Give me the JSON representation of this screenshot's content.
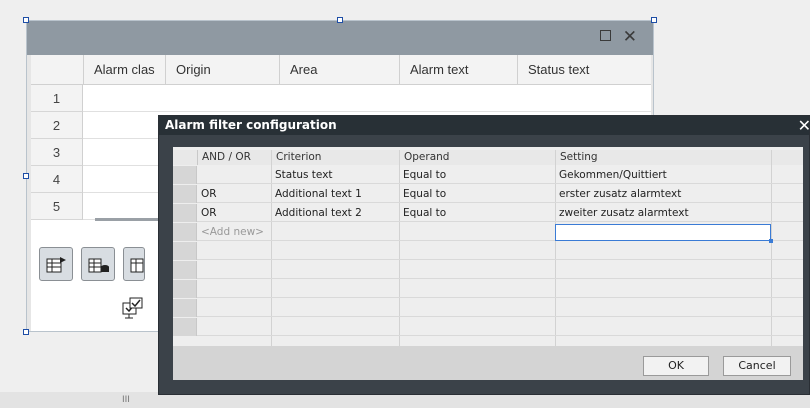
{
  "alarm_view": {
    "columns": [
      "Alarm clas",
      "Origin",
      "Area",
      "Alarm text",
      "Status text"
    ],
    "row_numbers": [
      "1",
      "2",
      "3",
      "4",
      "5"
    ],
    "toolbar_icons": [
      "table-arrow-icon",
      "table-db-icon",
      "table-filter-icon",
      "checklist-icon"
    ]
  },
  "dialog": {
    "title": "Alarm filter configuration",
    "close_symbol": "✕",
    "headers": [
      "AND / OR",
      "Criterion",
      "Operand",
      "Setting"
    ],
    "rows": [
      {
        "and_or": "",
        "criterion": "Status text",
        "operand": "Equal to",
        "setting": "Gekommen/Quittiert"
      },
      {
        "and_or": "OR",
        "criterion": "Additional text 1",
        "operand": "Equal to",
        "setting": "erster zusatz alarmtext"
      },
      {
        "and_or": "OR",
        "criterion": "Additional text 2",
        "operand": "Equal to",
        "setting": "zweiter zusatz alarmtext"
      }
    ],
    "add_new_label": "<Add new>",
    "ok_label": "OK",
    "cancel_label": "Cancel"
  },
  "scrollbar": {
    "grip": "III"
  }
}
